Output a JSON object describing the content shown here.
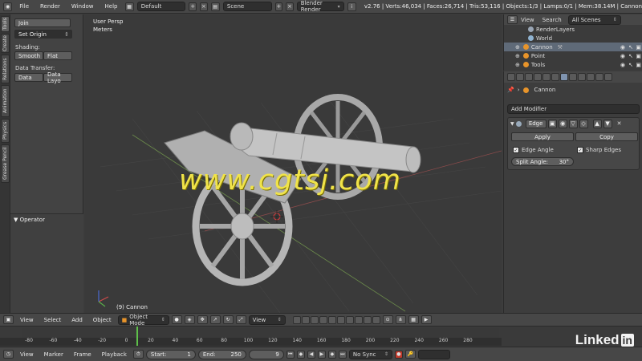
{
  "topbar": {
    "menus": [
      "File",
      "Render",
      "Window",
      "Help"
    ],
    "screen_layout": "Default",
    "scene": "Scene",
    "engine": "Blender Render",
    "stats": "v2.76 | Verts:46,034 | Faces:26,714 | Tris:53,116 | Objects:1/3 | Lamps:0/1 | Mem:38.14M | Cannon"
  },
  "toolshelf": {
    "tabs": [
      "Tools",
      "Create",
      "Relations",
      "Animation",
      "Physics",
      "Grease Pencil"
    ],
    "join_label": "Join",
    "set_origin_label": "Set Origin",
    "shading_label": "Shading:",
    "smooth_label": "Smooth",
    "flat_label": "Flat",
    "data_transfer_label": "Data Transfer:",
    "data_label": "Data",
    "data_layout_label": "Data Layo",
    "operator_label": "▼ Operator"
  },
  "viewport": {
    "view_name": "User Persp",
    "units": "Meters",
    "object_info": "(9) Cannon",
    "watermark": "www.cgtsj.com"
  },
  "outliner": {
    "view_label": "View",
    "search_label": "Search",
    "scenes_dropdown": "All Scenes",
    "rows": [
      {
        "name": "RenderLayers",
        "color": "#9aa6b5"
      },
      {
        "name": "World",
        "color": "#8fb3d1"
      },
      {
        "name": "Cannon",
        "color": "#e8942a"
      },
      {
        "name": "Point",
        "color": "#e8942a"
      },
      {
        "name": "Tools",
        "color": "#e8942a"
      }
    ]
  },
  "properties": {
    "breadcrumb": "Cannon",
    "add_modifier_label": "Add Modifier",
    "modifier_name": "Edge",
    "apply_label": "Apply",
    "copy_label": "Copy",
    "edge_angle_label": "Edge Angle",
    "sharp_edges_label": "Sharp Edges",
    "split_angle_label": "Split Angle:",
    "split_angle_value": "30°"
  },
  "view3d_header": {
    "view_label": "View",
    "select_label": "Select",
    "add_label": "Add",
    "object_label": "Object",
    "mode": "Object Mode",
    "transform_orientation": "View"
  },
  "timeline": {
    "ticks": [
      "-80",
      "-60",
      "-40",
      "-20",
      "0",
      "20",
      "40",
      "60",
      "80",
      "100",
      "120",
      "140",
      "160",
      "180",
      "200",
      "220",
      "240",
      "260",
      "280"
    ],
    "current_frame": 9,
    "view_label": "View",
    "marker_label": "Marker",
    "frame_label": "Frame",
    "playback_label": "Playback",
    "start_label": "Start:",
    "start_value": "1",
    "end_label": "End:",
    "end_value": "250",
    "frame_value": "9",
    "sync": "No Sync"
  },
  "brand": {
    "text": "Linked",
    "in": "in"
  }
}
